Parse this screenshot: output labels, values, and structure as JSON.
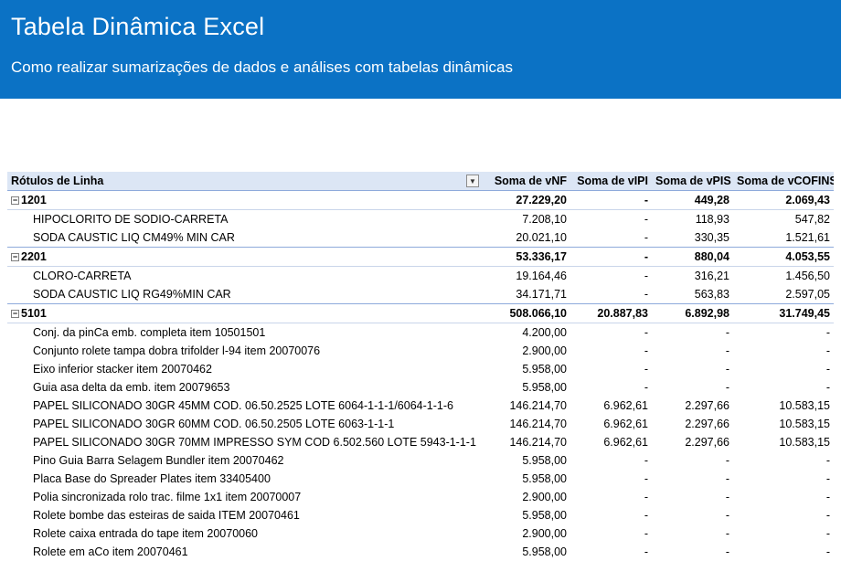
{
  "header": {
    "title": "Tabela Dinâmica Excel",
    "subtitle": "Como realizar sumarizações de dados e análises com tabelas dinâmicas"
  },
  "pivot": {
    "columns": {
      "row_labels": "Rótulos de Linha",
      "vnf": "Soma de vNF",
      "vipi": "Soma de vIPI",
      "vpis": "Soma de vPIS",
      "vcofins": "Soma de vCOFINS"
    },
    "groups": [
      {
        "code": "1201",
        "vnf": "27.229,20",
        "vipi": "-",
        "vpis": "449,28",
        "vcofins": "2.069,43",
        "items": [
          {
            "name": "HIPOCLORITO DE SODIO-CARRETA",
            "vnf": "7.208,10",
            "vipi": "-",
            "vpis": "118,93",
            "vcofins": "547,82"
          },
          {
            "name": "SODA CAUSTIC LIQ CM49% MIN CAR",
            "vnf": "20.021,10",
            "vipi": "-",
            "vpis": "330,35",
            "vcofins": "1.521,61"
          }
        ]
      },
      {
        "code": "2201",
        "vnf": "53.336,17",
        "vipi": "-",
        "vpis": "880,04",
        "vcofins": "4.053,55",
        "items": [
          {
            "name": "CLORO-CARRETA",
            "vnf": "19.164,46",
            "vipi": "-",
            "vpis": "316,21",
            "vcofins": "1.456,50"
          },
          {
            "name": "SODA CAUSTIC LIQ RG49%MIN CAR",
            "vnf": "34.171,71",
            "vipi": "-",
            "vpis": "563,83",
            "vcofins": "2.597,05"
          }
        ]
      },
      {
        "code": "5101",
        "vnf": "508.066,10",
        "vipi": "20.887,83",
        "vpis": "6.892,98",
        "vcofins": "31.749,45",
        "items": [
          {
            "name": "Conj. da pinCa emb. completa item 10501501",
            "vnf": "4.200,00",
            "vipi": "-",
            "vpis": "-",
            "vcofins": "-"
          },
          {
            "name": "Conjunto rolete tampa dobra trifolder l-94 item 20070076",
            "vnf": "2.900,00",
            "vipi": "-",
            "vpis": "-",
            "vcofins": "-"
          },
          {
            "name": "Eixo inferior stacker item 20070462",
            "vnf": "5.958,00",
            "vipi": "-",
            "vpis": "-",
            "vcofins": "-"
          },
          {
            "name": "Guia asa delta da emb. item 20079653",
            "vnf": "5.958,00",
            "vipi": "-",
            "vpis": "-",
            "vcofins": "-"
          },
          {
            "name": "PAPEL SILICONADO 30GR 45MM COD. 06.50.2525 LOTE 6064-1-1-1/6064-1-1-6",
            "vnf": "146.214,70",
            "vipi": "6.962,61",
            "vpis": "2.297,66",
            "vcofins": "10.583,15"
          },
          {
            "name": "PAPEL SILICONADO 30GR 60MM COD. 06.50.2505 LOTE 6063-1-1-1",
            "vnf": "146.214,70",
            "vipi": "6.962,61",
            "vpis": "2.297,66",
            "vcofins": "10.583,15"
          },
          {
            "name": "PAPEL SILICONADO 30GR 70MM IMPRESSO SYM COD 6.502.560 LOTE 5943-1-1-1",
            "vnf": "146.214,70",
            "vipi": "6.962,61",
            "vpis": "2.297,66",
            "vcofins": "10.583,15"
          },
          {
            "name": "Pino Guia Barra Selagem Bundler item 20070462",
            "vnf": "5.958,00",
            "vipi": "-",
            "vpis": "-",
            "vcofins": "-"
          },
          {
            "name": "Placa Base do Spreader Plates item 33405400",
            "vnf": "5.958,00",
            "vipi": "-",
            "vpis": "-",
            "vcofins": "-"
          },
          {
            "name": "Polia sincronizada rolo trac. filme 1x1 item 20070007",
            "vnf": "2.900,00",
            "vipi": "-",
            "vpis": "-",
            "vcofins": "-"
          },
          {
            "name": "Rolete bombe das esteiras de saida ITEM 20070461",
            "vnf": "5.958,00",
            "vipi": "-",
            "vpis": "-",
            "vcofins": "-"
          },
          {
            "name": "Rolete caixa entrada do tape item 20070060",
            "vnf": "2.900,00",
            "vipi": "-",
            "vpis": "-",
            "vcofins": "-"
          },
          {
            "name": "Rolete em aCo item 20070461",
            "vnf": "5.958,00",
            "vipi": "-",
            "vpis": "-",
            "vcofins": "-"
          }
        ]
      }
    ]
  },
  "icons": {
    "collapse": "minus-box-icon",
    "filter": "dropdown-filter-icon"
  },
  "colors": {
    "banner": "#0b72c5",
    "header_fill": "#dce6f5",
    "border": "#8eaadb"
  }
}
